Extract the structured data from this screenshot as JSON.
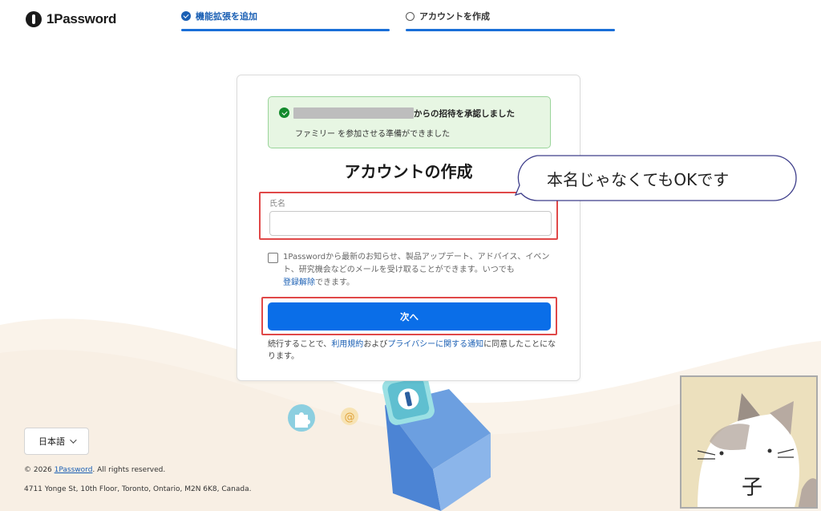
{
  "brand": {
    "name": "1Password"
  },
  "steps": [
    {
      "label": "機能拡張を追加",
      "state": "done"
    },
    {
      "label": "アカウントを作成",
      "state": "pending"
    }
  ],
  "notice": {
    "invite_text": "からの招待を承認しました",
    "sub_text": "ファミリー を参加させる準備ができました"
  },
  "form": {
    "title": "アカウントの作成",
    "name_label": "氏名",
    "name_value": "",
    "optin_text": "1Passwordから最新のお知らせ、製品アップデート、アドバイス、イベント、研究機会などのメールを受け取ることができます。いつでも",
    "optin_link": "登録解除",
    "optin_suffix": "できます。",
    "next_label": "次へ",
    "terms_prefix": "続行することで、",
    "terms_link1": "利用規約",
    "terms_mid": "および",
    "terms_link2": "プライバシーに関する通知",
    "terms_suffix": "に同意したことになります。"
  },
  "callout": {
    "text": "本名じゃなくてもOKです"
  },
  "footer": {
    "language": "日本語",
    "copyright_prefix": "© 2026 ",
    "copyright_link": "1Password",
    "copyright_suffix": ". All rights reserved.",
    "address": "4711 Yonge St, 10th Floor, Toronto, Ontario, M2N 6K8, Canada."
  },
  "inset": {
    "label": "子"
  },
  "colors": {
    "accent": "#0a6ee8",
    "link": "#1a5fb4",
    "success_bg": "#e7f6e3",
    "highlight": "#e04848"
  },
  "icons": [
    "logo-icon",
    "check-circle-icon",
    "empty-circle-icon",
    "success-check-icon",
    "chevron-down-icon",
    "checkbox-icon"
  ]
}
